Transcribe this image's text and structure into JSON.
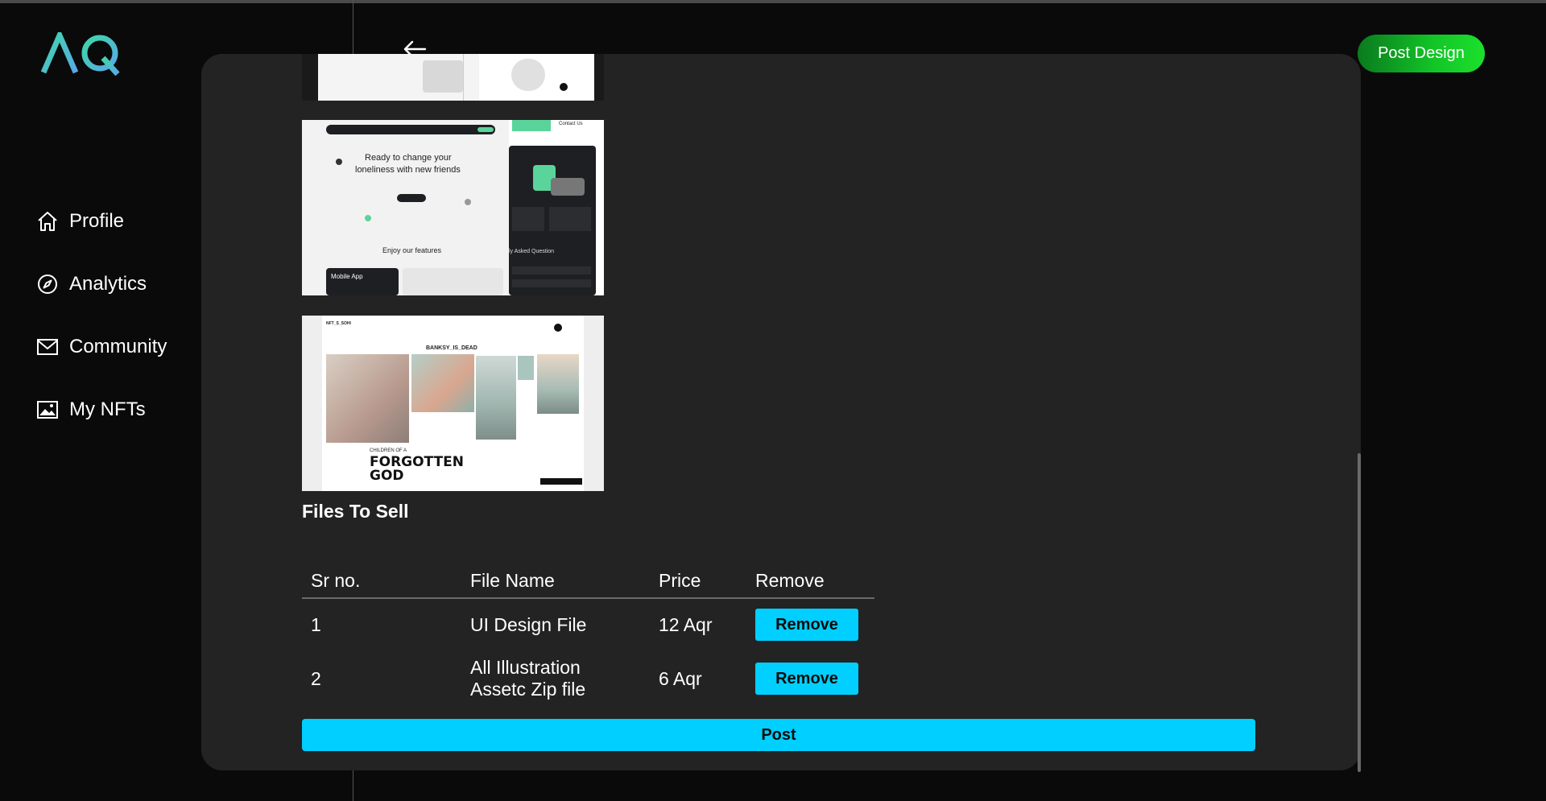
{
  "app": {
    "logo_text": "AQ"
  },
  "sidebar": {
    "items": [
      {
        "label": "Profile",
        "icon": "home-icon"
      },
      {
        "label": "Analytics",
        "icon": "compass-icon"
      },
      {
        "label": "Community",
        "icon": "mail-icon"
      },
      {
        "label": "My NFTs",
        "icon": "image-icon"
      }
    ]
  },
  "header": {
    "post_design_label": "Post Design"
  },
  "thumbnails": {
    "design2": {
      "heading_line1": "Ready to change your",
      "heading_line2": "loneliness with new friends",
      "features": "Enjoy our features",
      "mobile_app": "Mobile App",
      "faq": "ly Asked Question",
      "contact": "Contact Us"
    },
    "design3": {
      "brand": "NFT_S_SOHI",
      "title": "BANKSY_IS_DEAD",
      "headline_small": "CHILDREN OF A",
      "headline_big1": "FORGOTTEN",
      "headline_big2": "GOD"
    }
  },
  "files_section": {
    "title": "Files To Sell",
    "columns": [
      "Sr no.",
      "File Name",
      "Price",
      "Remove"
    ],
    "rows": [
      {
        "sr": "1",
        "name": "UI Design File",
        "price": "12 Aqr",
        "action": "Remove"
      },
      {
        "sr": "2",
        "name_line1": "All Illustration",
        "name_line2": "Assetc Zip file",
        "price": "6 Aqr",
        "action": "Remove"
      }
    ],
    "post_label": "Post"
  },
  "colors": {
    "accent_cyan": "#00cfff",
    "green_button": "#13c527",
    "panel_bg": "#232323",
    "page_bg": "#0a0a0a"
  }
}
